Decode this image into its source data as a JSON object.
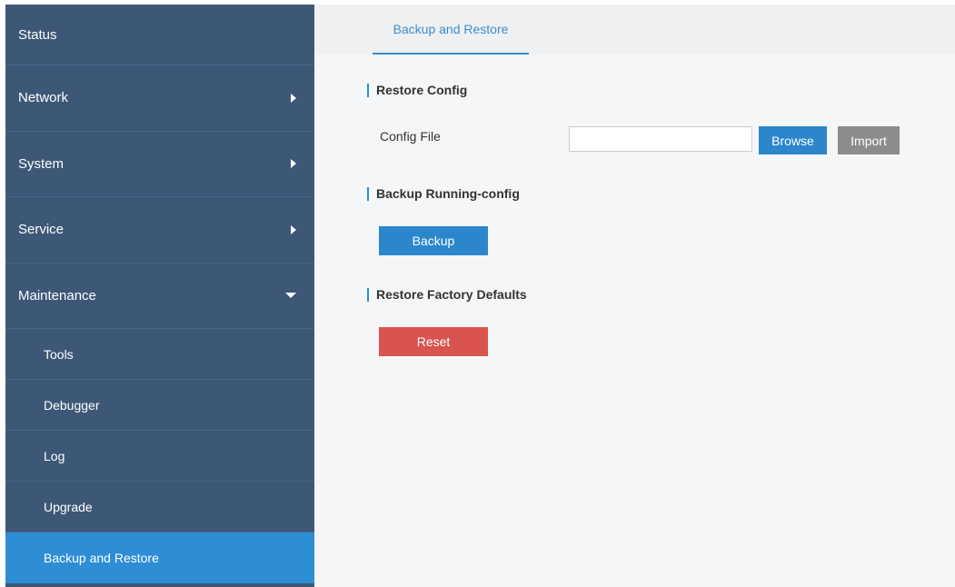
{
  "sidebar": {
    "items": [
      {
        "label": "Status"
      },
      {
        "label": "Network"
      },
      {
        "label": "System"
      },
      {
        "label": "Service"
      },
      {
        "label": "Maintenance"
      }
    ],
    "maintenance_sub": [
      {
        "label": "Tools"
      },
      {
        "label": "Debugger"
      },
      {
        "label": "Log"
      },
      {
        "label": "Upgrade"
      },
      {
        "label": "Backup and Restore"
      }
    ]
  },
  "tabs": [
    {
      "label": "Backup and Restore"
    }
  ],
  "restore_config": {
    "title": "Restore Config",
    "field_label": "Config File",
    "file_value": "",
    "browse_label": "Browse",
    "import_label": "Import"
  },
  "backup_running": {
    "title": "Backup Running-config",
    "backup_label": "Backup"
  },
  "factory_defaults": {
    "title": "Restore Factory Defaults",
    "reset_label": "Reset"
  },
  "colors": {
    "sidebar_bg": "#3d5877",
    "active_item": "#2d8ed6",
    "primary_button": "#2b86cc",
    "secondary_button": "#8c8c8c",
    "danger_button": "#d9534f"
  }
}
